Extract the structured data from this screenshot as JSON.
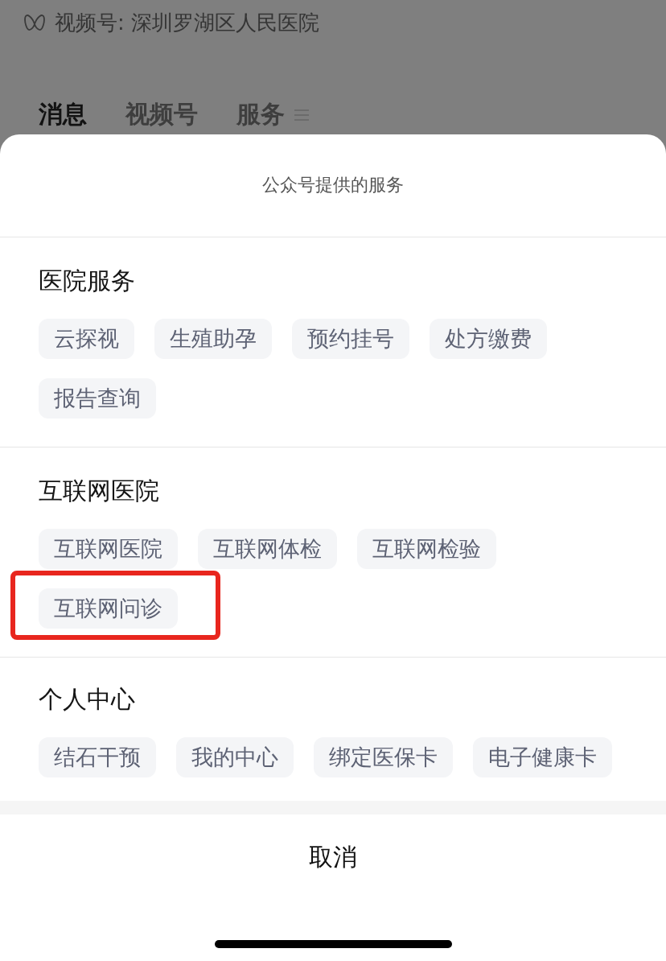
{
  "header": {
    "title": "视频号: 深圳罗湖区人民医院"
  },
  "tabs": [
    {
      "label": "消息",
      "selected": true,
      "menu": false
    },
    {
      "label": "视频号",
      "selected": false,
      "menu": false
    },
    {
      "label": "服务",
      "selected": false,
      "menu": true
    }
  ],
  "sheet": {
    "title": "公众号提供的服务",
    "sections": [
      {
        "title": "医院服务",
        "items": [
          {
            "label": "云探视",
            "highlighted": false
          },
          {
            "label": "生殖助孕",
            "highlighted": false
          },
          {
            "label": "预约挂号",
            "highlighted": false
          },
          {
            "label": "处方缴费",
            "highlighted": false
          },
          {
            "label": "报告查询",
            "highlighted": false
          }
        ]
      },
      {
        "title": "互联网医院",
        "items": [
          {
            "label": "互联网医院",
            "highlighted": false
          },
          {
            "label": "互联网体检",
            "highlighted": false
          },
          {
            "label": "互联网检验",
            "highlighted": false
          },
          {
            "label": "互联网问诊",
            "highlighted": true
          }
        ]
      },
      {
        "title": "个人中心",
        "items": [
          {
            "label": "结石干预",
            "highlighted": false
          },
          {
            "label": "我的中心",
            "highlighted": false
          },
          {
            "label": "绑定医保卡",
            "highlighted": false
          },
          {
            "label": "电子健康卡",
            "highlighted": false
          }
        ]
      }
    ],
    "cancel": "取消"
  }
}
